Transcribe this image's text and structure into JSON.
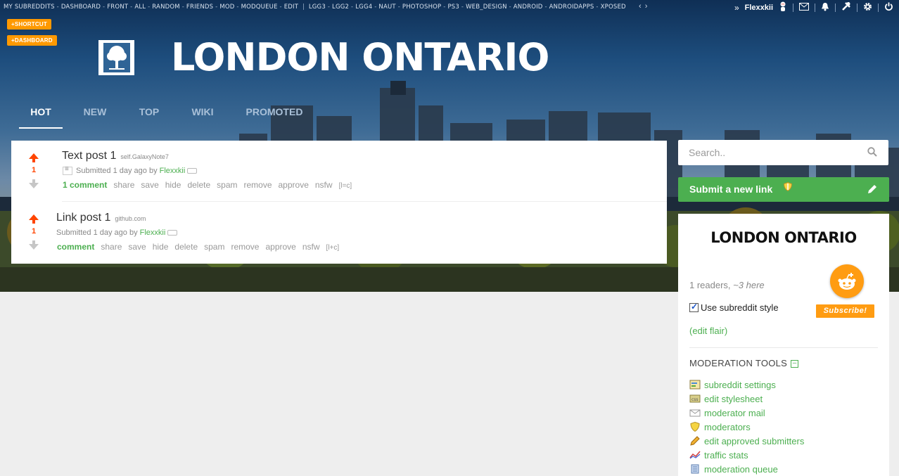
{
  "topbar": {
    "subreddits": [
      "MY SUBREDDITS",
      "DASHBOARD",
      "FRONT",
      "ALL",
      "RANDOM",
      "FRIENDS",
      "MOD",
      "MODQUEUE",
      "EDIT"
    ],
    "subscriptions": [
      "LGG3",
      "LGG2",
      "LGG4",
      "NAUT",
      "PHOTOSHOP",
      "PS3",
      "WEB_DESIGN",
      "ANDROID",
      "ANDROIDAPPS",
      "XPOSED"
    ],
    "expand_label": "‹ ›",
    "username": "Flexxkii",
    "icons": [
      "double-chevron-icon",
      "avatar-icon",
      "mail-icon",
      "bell-icon",
      "tools-icon",
      "gear-icon",
      "power-icon"
    ]
  },
  "shortcut_buttons": {
    "shortcut": "+SHORTCUT",
    "dashboard": "+DASHBOARD"
  },
  "banner": {
    "title": "LONDON ONTARIO"
  },
  "tabs": [
    "HOT",
    "NEW",
    "TOP",
    "WIKI",
    "PROMOTED"
  ],
  "posts": [
    {
      "title": "Text post 1",
      "domain": "self.GalaxyNote7",
      "score": "1",
      "tagline_prefix": "Submitted 1 day ago by ",
      "author": "Flexxkii",
      "buttons": [
        "1 comment",
        "share",
        "save",
        "hide",
        "delete",
        "spam",
        "remove",
        "approve",
        "nsfw",
        "[l=c]"
      ]
    },
    {
      "title": "Link post 1",
      "domain": "github.com",
      "score": "1",
      "tagline_prefix": "Submitted 1 day ago by ",
      "author": "Flexxkii",
      "buttons": [
        "comment",
        "share",
        "save",
        "hide",
        "delete",
        "spam",
        "remove",
        "approve",
        "nsfw",
        "[l+c]"
      ]
    }
  ],
  "sidebar": {
    "search_placeholder": "Search..",
    "submit_label": "Submit a new link",
    "subreddit_name": "LONDON ONTARIO",
    "readers": "1 readers,",
    "here": "~3 here",
    "subscribe_label": "Subscribe!",
    "use_style_label": "Use subreddit style",
    "edit_flair": "(edit flair)",
    "mod_tools_title": "MODERATION TOOLS",
    "mod_tools": [
      {
        "label": "subreddit settings",
        "icon": "settings-icon"
      },
      {
        "label": "edit stylesheet",
        "icon": "css-icon"
      },
      {
        "label": "moderator mail",
        "icon": "mail-icon"
      },
      {
        "label": "moderators",
        "icon": "shield-icon"
      },
      {
        "label": "edit approved submitters",
        "icon": "pencil-icon"
      },
      {
        "label": "traffic stats",
        "icon": "chart-icon"
      },
      {
        "label": "moderation queue",
        "icon": "queue-icon"
      }
    ]
  },
  "colors": {
    "accent_green": "#4caf50",
    "orange": "#ff9900",
    "upvote": "#ff4500"
  }
}
